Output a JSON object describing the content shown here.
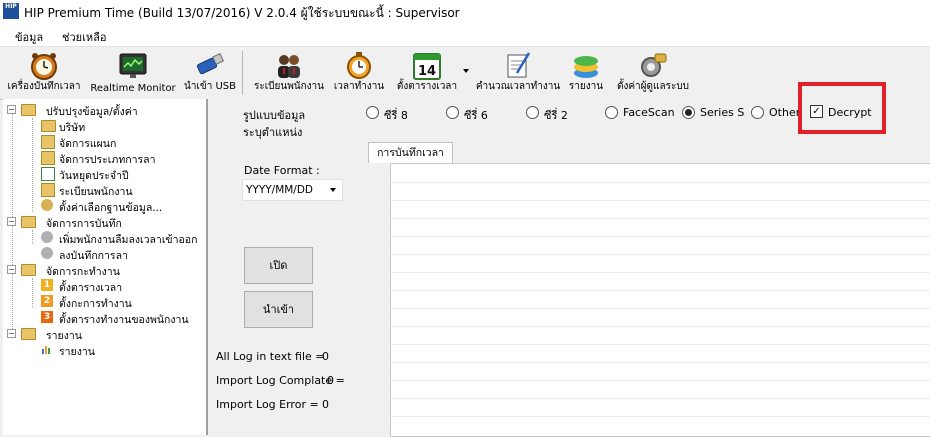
{
  "window": {
    "title": "HIP Premium Time (Build 13/07/2016) V 2.0.4   ผู้ใช้ระบบขณะนี้ : Supervisor",
    "icon_label": "HIP"
  },
  "menu": {
    "items": [
      "ข้อมูล",
      "ช่วยเหลือ"
    ]
  },
  "toolbar": {
    "buttons": [
      {
        "label": "เครื่องบันทึกเวลา",
        "icon": "clock-icon"
      },
      {
        "label": "Realtime Monitor",
        "icon": "monitor-icon"
      },
      {
        "label": "นำเข้า USB",
        "icon": "usb-icon"
      },
      {
        "label": "ระเบียนพนักงาน",
        "icon": "people-icon"
      },
      {
        "label": "เวลาทำงาน",
        "icon": "timer-icon"
      },
      {
        "label": "ตั้งตารางเวลา",
        "icon": "calendar-icon",
        "calendar_day": "14"
      },
      {
        "label": "คำนวณเวลาทำงาน",
        "icon": "calculate-icon"
      },
      {
        "label": "รายงาน",
        "icon": "report-icon"
      },
      {
        "label": "ตั้งค่าผู้ดูแลระบบ",
        "icon": "admin-settings-icon"
      }
    ],
    "colors": {
      "accent": "#2b5fb8"
    }
  },
  "tree": {
    "groups": [
      {
        "label": "ปรับปรุงข้อมูล/ตั้งค่า",
        "expander": "-",
        "items": [
          "บริษัท",
          "จัดการแผนก",
          "จัดการประเภทการลา",
          "วันหยุดประจำปี",
          "ระเบียนพนักงาน",
          "ตั้งค่าเลือกฐานข้อมูล..."
        ]
      },
      {
        "label": "จัดการการบันทึก",
        "expander": "-",
        "items": [
          "เพิ่มพนักงานลืมลงเวลาเข้าออก",
          "ลงบันทึกการลา"
        ]
      },
      {
        "label": "จัดการกะทำงาน",
        "expander": "-",
        "items": [
          "ตั้งตารางเวลา",
          "ตั้งกะการทำงาน",
          "ตั้งตารางทำงานของพนักงาน"
        ],
        "numbers": [
          "1",
          "2",
          "3"
        ]
      },
      {
        "label": "รายงาน",
        "expander": "-",
        "items": [
          "รายงาน"
        ]
      }
    ]
  },
  "main": {
    "format_label": "รูปแบบข้อมูล",
    "position_label": "ระบุตำแหน่ง",
    "radios": [
      {
        "label": "ซีรี่ 8",
        "checked": false
      },
      {
        "label": "ซีรี่ 6",
        "checked": false
      },
      {
        "label": "ซีรี่ 2",
        "checked": false
      },
      {
        "label": "FaceScan",
        "checked": false
      },
      {
        "label": "Series S",
        "checked": true
      },
      {
        "label": "Other",
        "checked": false
      }
    ],
    "decrypt": {
      "label": "Decrypt",
      "checked": true,
      "check_glyph": "✓"
    },
    "date_format_label": "Date Format :",
    "date_format_value": "YYYY/MM/DD",
    "open_button": "เปิด",
    "import_button": "นำเข้า",
    "tab_label": "การบันทึกเวลา",
    "stats": [
      {
        "label": "All Log in text file =",
        "value": "0"
      },
      {
        "label": "Import Log Complate =",
        "value": "0"
      },
      {
        "label": "Import Log Error =",
        "value": "0"
      }
    ],
    "highlight_color": "#e0202a"
  }
}
